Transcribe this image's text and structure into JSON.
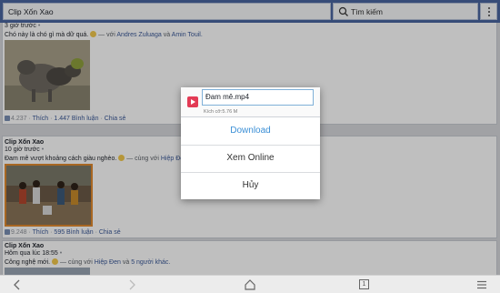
{
  "header": {
    "title": "Clip Xốn Xao",
    "search_label": "Tìm kiếm"
  },
  "posts": [
    {
      "time_prefix": "3 giờ trước",
      "text": "Chó này là chó gì mà dữ quá.",
      "with_label": "— với",
      "tag1": "Andres Zuluaga",
      "and_label": "và",
      "tag2": "Amin Touil.",
      "likes": "4.237",
      "like_label": "Thích",
      "comments": "1.447 Bình luận",
      "share_label": "Chia sẻ"
    },
    {
      "name": "Clip Xốn Xao",
      "time": "10 giờ trước",
      "text": "Đam mê vượt khoảng cách giàu nghèo.",
      "with_label": "— cùng với",
      "tag1": "Hiệp Đen",
      "likes": "9.248",
      "like_label": "Thích",
      "comments": "595 Bình luận",
      "share_label": "Chia sẻ"
    },
    {
      "name": "Clip Xốn Xao",
      "time": "Hôm qua lúc 18:55",
      "text": "Công nghệ mới.",
      "with_label": "— cùng với",
      "tag1": "Hiệp Đen",
      "and_label": "và",
      "tag2": "5 người khác."
    }
  ],
  "dialog": {
    "filename": "Đam mê.mp4",
    "size": "Kích cỡ:5.76 M",
    "download": "Download",
    "watch_online": "Xem Online",
    "cancel": "Hủy"
  },
  "colors": {
    "header": "#4a66a0",
    "link": "#3b5998",
    "download": "#3b8fd6",
    "logo": "#e33b55"
  },
  "icons": [
    "search-icon",
    "overflow-menu-icon",
    "app-logo-icon",
    "back-icon",
    "forward-icon",
    "home-icon",
    "tabs-icon",
    "menu-icon",
    "like-icon"
  ],
  "nav": {
    "tab_count": "1"
  }
}
